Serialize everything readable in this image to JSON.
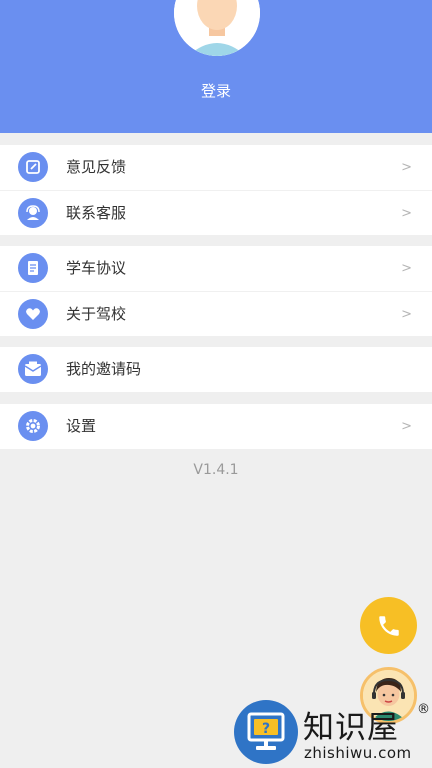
{
  "header": {
    "login_label": "登录"
  },
  "menu": {
    "group1": [
      {
        "label": "意见反馈",
        "arrow": ">"
      },
      {
        "label": "联系客服",
        "arrow": ">"
      }
    ],
    "group2": [
      {
        "label": "学车协议",
        "arrow": ">"
      },
      {
        "label": "关于驾校",
        "arrow": ">"
      }
    ],
    "group3": [
      {
        "label": "我的邀请码",
        "arrow": ""
      }
    ],
    "group4": [
      {
        "label": "设置",
        "arrow": ">"
      }
    ]
  },
  "version": "V1.4.1",
  "watermark": {
    "title": "知识屋",
    "reg": "®",
    "url": "zhishiwu.com"
  },
  "colors": {
    "header_bg": "#6a8ff0",
    "icon_bg": "#6a8ff0",
    "phone_button": "#f7bf25"
  }
}
